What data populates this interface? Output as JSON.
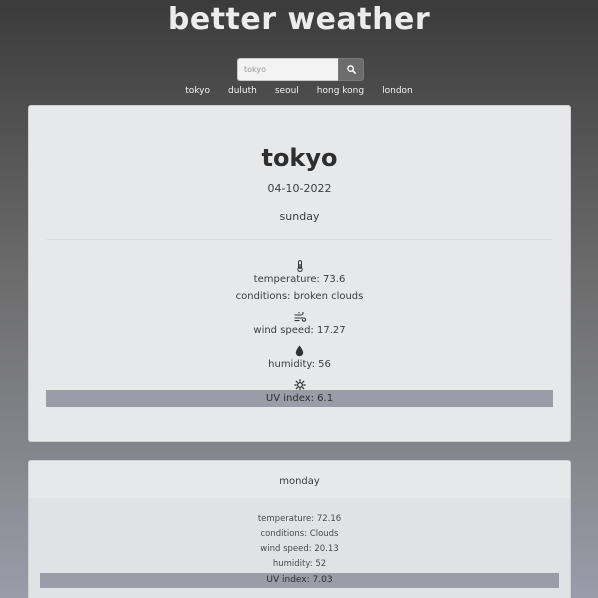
{
  "header": {
    "title": "better weather"
  },
  "search": {
    "placeholder": "tokyo",
    "value": ""
  },
  "cities": [
    "tokyo",
    "duluth",
    "seoul",
    "hong kong",
    "london"
  ],
  "current": {
    "city": "tokyo",
    "date": "04-10-2022",
    "day": "sunday",
    "temperature": "temperature: 73.6",
    "conditions": "conditions: broken clouds",
    "wind": "wind speed: 17.27",
    "humidity": "humidity: 56",
    "uv": "UV index: 6.1"
  },
  "forecast": [
    {
      "day": "monday",
      "temperature": "temperature: 72.16",
      "conditions": "conditions: Clouds",
      "wind": "wind speed: 20.13",
      "humidity": "humidity: 52",
      "uv": "UV index: 7.03"
    }
  ],
  "colors": {
    "uv_bar": "#9a9ca8",
    "card": "#e7e8ea",
    "title": "#ececec"
  },
  "icons": [
    "search-icon",
    "thermometer-icon",
    "wind-icon",
    "droplet-icon",
    "sun-icon"
  ]
}
